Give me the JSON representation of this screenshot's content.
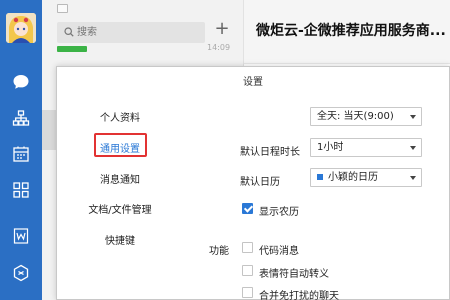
{
  "chat_list": {
    "search_placeholder": "搜索",
    "add_icon": "plus-icon",
    "item_time": "14:09"
  },
  "chat_header": {
    "title": "微炬云-企微推荐应用服务商..."
  },
  "nav": {
    "icons": [
      "chat-bubble-icon",
      "org-structure-icon",
      "calendar-icon",
      "apps-grid-icon",
      "doc-w-icon",
      "workbench-cube-icon"
    ],
    "accent": "#2b6fc4"
  },
  "dialog": {
    "title": "设置",
    "menu": [
      {
        "label": "个人资料",
        "active": false
      },
      {
        "label": "通用设置",
        "active": true
      },
      {
        "label": "消息通知",
        "active": false
      },
      {
        "label": "文档/文件管理",
        "active": false
      },
      {
        "label": "快捷键",
        "active": false
      }
    ],
    "allday_select": "全天: 当天(9:00)",
    "default_duration": {
      "label": "默认日程时长",
      "value": "1小时"
    },
    "default_calendar": {
      "label": "默认日历",
      "value": "小颖的日历"
    },
    "show_lunar": {
      "label": "显示农历",
      "checked": true
    },
    "features": {
      "label": "功能",
      "options": [
        {
          "label": "代码消息",
          "checked": false
        },
        {
          "label": "表情符自动转义",
          "checked": false
        },
        {
          "label": "合并免打扰的聊天",
          "checked": false
        }
      ]
    },
    "colors": {
      "active_text": "#2a78d6",
      "highlight_frame": "#e23232",
      "checkbox_on": "#2a78d6"
    }
  }
}
